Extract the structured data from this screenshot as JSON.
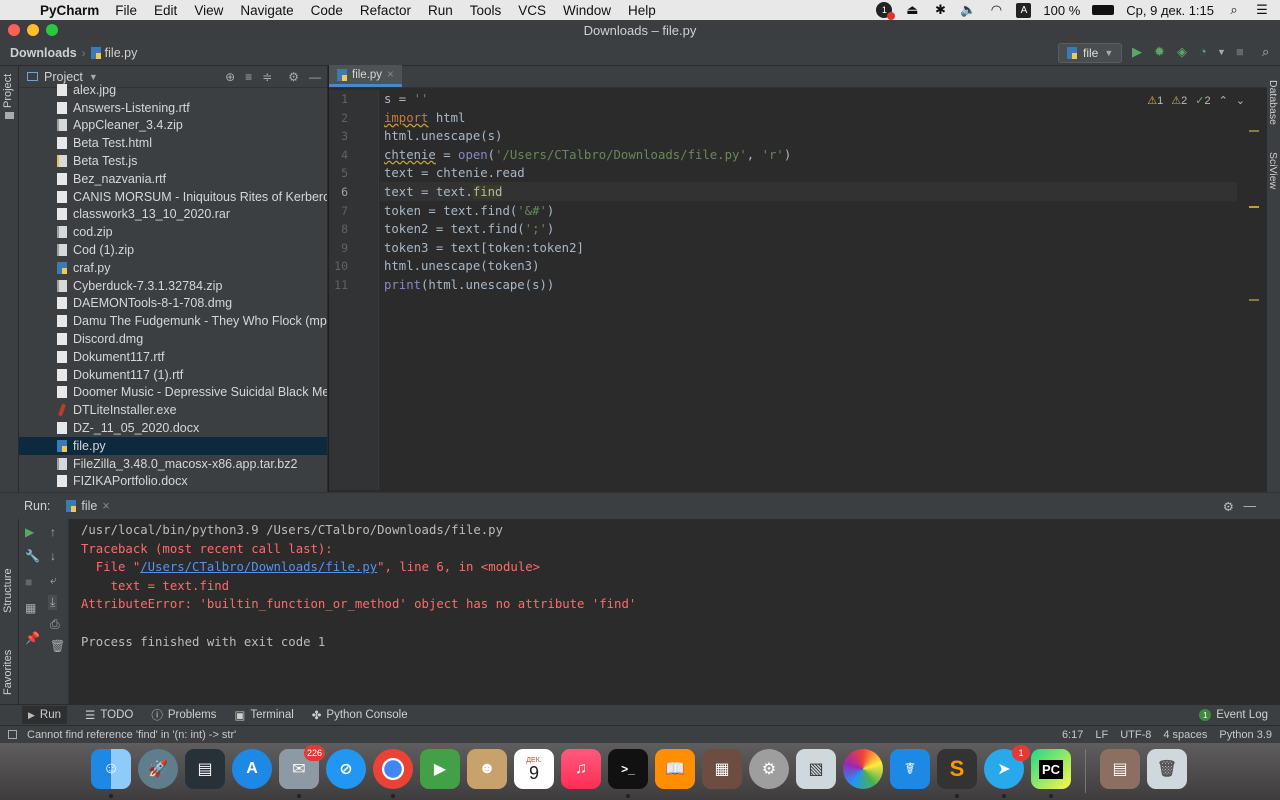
{
  "menubar": {
    "app_name": "PyCharm",
    "menus": [
      "File",
      "Edit",
      "View",
      "Navigate",
      "Code",
      "Refactor",
      "Run",
      "Tools",
      "VCS",
      "Window",
      "Help"
    ],
    "badge_count": "1",
    "input_source": "A",
    "battery": "100 %",
    "clock": "Ср, 9 дек. 1:15"
  },
  "window": {
    "title": "Downloads – file.py"
  },
  "navbar": {
    "breadcrumb_folder": "Downloads",
    "breadcrumb_file": "file.py",
    "run_config": "file"
  },
  "left_strip": {
    "project_tab": "Project",
    "structure_tab": "Structure",
    "favorites_tab": "Favorites"
  },
  "right_strip": {
    "database_tab": "Database",
    "sciview_tab": "SciView"
  },
  "project": {
    "title": "Project",
    "files": [
      {
        "name": "alex.jpg",
        "type": "file"
      },
      {
        "name": "Answers-Listening.rtf",
        "type": "file"
      },
      {
        "name": "AppCleaner_3.4.zip",
        "type": "arc"
      },
      {
        "name": "Beta Test.html",
        "type": "file"
      },
      {
        "name": "Beta Test.js",
        "type": "js"
      },
      {
        "name": "Bez_nazvania.rtf",
        "type": "file"
      },
      {
        "name": "CANIS MORSUM - Iniquitous Rites of Kerberos",
        "type": "file"
      },
      {
        "name": "classwork3_13_10_2020.rar",
        "type": "file"
      },
      {
        "name": "cod.zip",
        "type": "arc"
      },
      {
        "name": "Cod (1).zip",
        "type": "arc"
      },
      {
        "name": "craf.py",
        "type": "py"
      },
      {
        "name": "Cyberduck-7.3.1.32784.zip",
        "type": "arc"
      },
      {
        "name": "DAEMONTools-8-1-708.dmg",
        "type": "file"
      },
      {
        "name": "Damu The Fudgemunk - They Who Flock (mp3",
        "type": "file"
      },
      {
        "name": "Discord.dmg",
        "type": "file"
      },
      {
        "name": "Dokument117.rtf",
        "type": "file"
      },
      {
        "name": "Dokument117 (1).rtf",
        "type": "file"
      },
      {
        "name": "Doomer Music - Depressive Suicidal Black Meta",
        "type": "file"
      },
      {
        "name": "DTLiteInstaller.exe",
        "type": "exe"
      },
      {
        "name": "DZ-_11_05_2020.docx",
        "type": "file"
      },
      {
        "name": "file.py",
        "type": "py",
        "selected": true
      },
      {
        "name": "FileZilla_3.48.0_macosx-x86.app.tar.bz2",
        "type": "arc"
      },
      {
        "name": "FIZIKAPortfolio.docx",
        "type": "file"
      }
    ]
  },
  "editor": {
    "tab": "file.py",
    "inspections": {
      "warnings": "1",
      "weak_warnings": "2",
      "typos": "2"
    },
    "line_numbers": [
      "1",
      "2",
      "3",
      "4",
      "5",
      "6",
      "7",
      "8",
      "9",
      "10",
      "11"
    ],
    "current_line": 6,
    "code_lines": [
      "s = ''",
      "import html",
      "html.unescape(s)",
      "chtenie = open('/Users/CTalbro/Downloads/file.py', 'r')",
      "text = chtenie.read",
      "text = text.find",
      "token = text.find('&#')",
      "token2 = text.find(';')",
      "token3 = text[token:token2]",
      "html.unescape(token3)",
      "print(html.unescape(s))"
    ]
  },
  "run": {
    "label": "Run:",
    "tab": "file",
    "output": {
      "command": "/usr/local/bin/python3.9 /Users/CTalbro/Downloads/file.py",
      "traceback": "Traceback (most recent call last):",
      "file_prefix": "  File \"",
      "file_link": "/Users/CTalbro/Downloads/file.py",
      "file_suffix": "\", line 6, in <module>",
      "code": "    text = text.find",
      "error": "AttributeError: 'builtin_function_or_method' object has no attribute 'find'",
      "exit": "Process finished with exit code 1"
    }
  },
  "bottom_tools": {
    "run": "Run",
    "todo": "TODO",
    "problems": "Problems",
    "terminal": "Terminal",
    "python_console": "Python Console",
    "event_log": "Event Log",
    "event_count": "1"
  },
  "status": {
    "message": "Cannot find reference 'find' in '(n: int) -> str'",
    "position": "6:17",
    "line_sep": "LF",
    "encoding": "UTF-8",
    "indent": "4 spaces",
    "interpreter": "Python 3.9"
  },
  "dock": {
    "mail_badge": "226",
    "calendar_month": "ДЕК.",
    "calendar_day": "9",
    "telegram_badge": "1",
    "pycharm_label": "PC"
  }
}
